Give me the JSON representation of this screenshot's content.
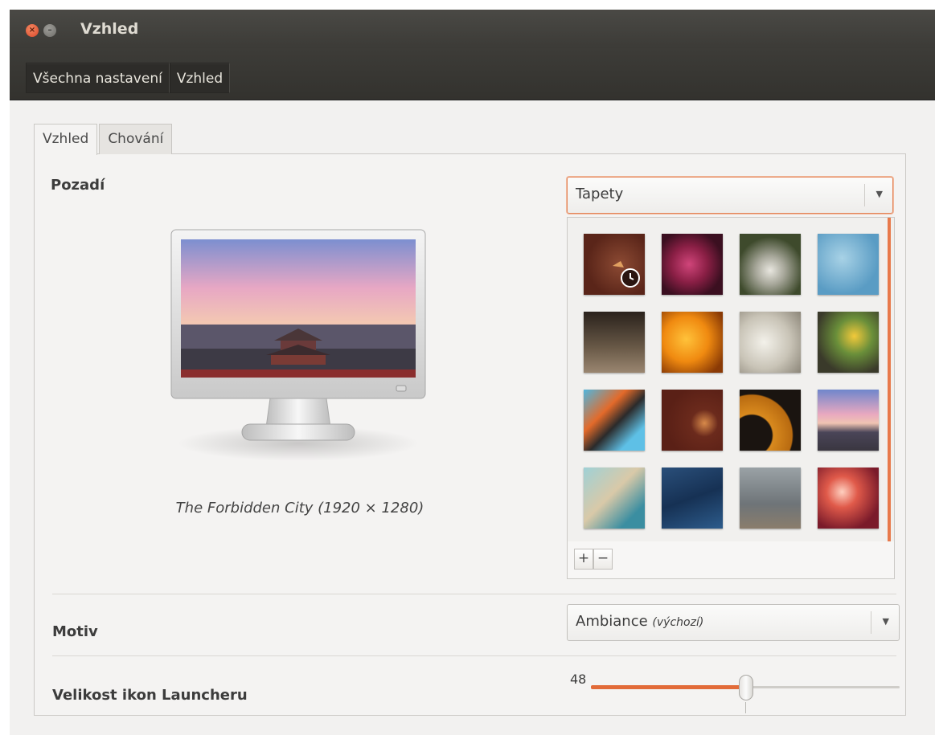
{
  "window": {
    "title": "Vzhled",
    "close_glyph": "×",
    "minimize_glyph": "–"
  },
  "breadcrumb": {
    "items": [
      "Všechna nastavení",
      "Vzhled"
    ]
  },
  "tabs": [
    "Vzhled",
    "Chování"
  ],
  "background": {
    "label": "Pozadí",
    "source_value": "Tapety",
    "caption": "The Forbidden City (1920 × 1280)",
    "add_label": "+",
    "remove_label": "−"
  },
  "theme": {
    "label": "Motiv",
    "value": "Ambiance",
    "value_note": "(výchozí)"
  },
  "launcher": {
    "label": "Velikost ikon Launcheru",
    "value_label": "48",
    "fill_fraction": 0.5
  },
  "colors": {
    "accent": "#e26b39",
    "titlebar": "#3c3b37",
    "window_bg": "#f2f1f0"
  },
  "icons": {
    "close": "close-icon",
    "minimize": "minimize-icon",
    "dropdown": "chevron-down-icon",
    "selected": "clock-badge-icon"
  },
  "dropdown_arrow": "▼"
}
